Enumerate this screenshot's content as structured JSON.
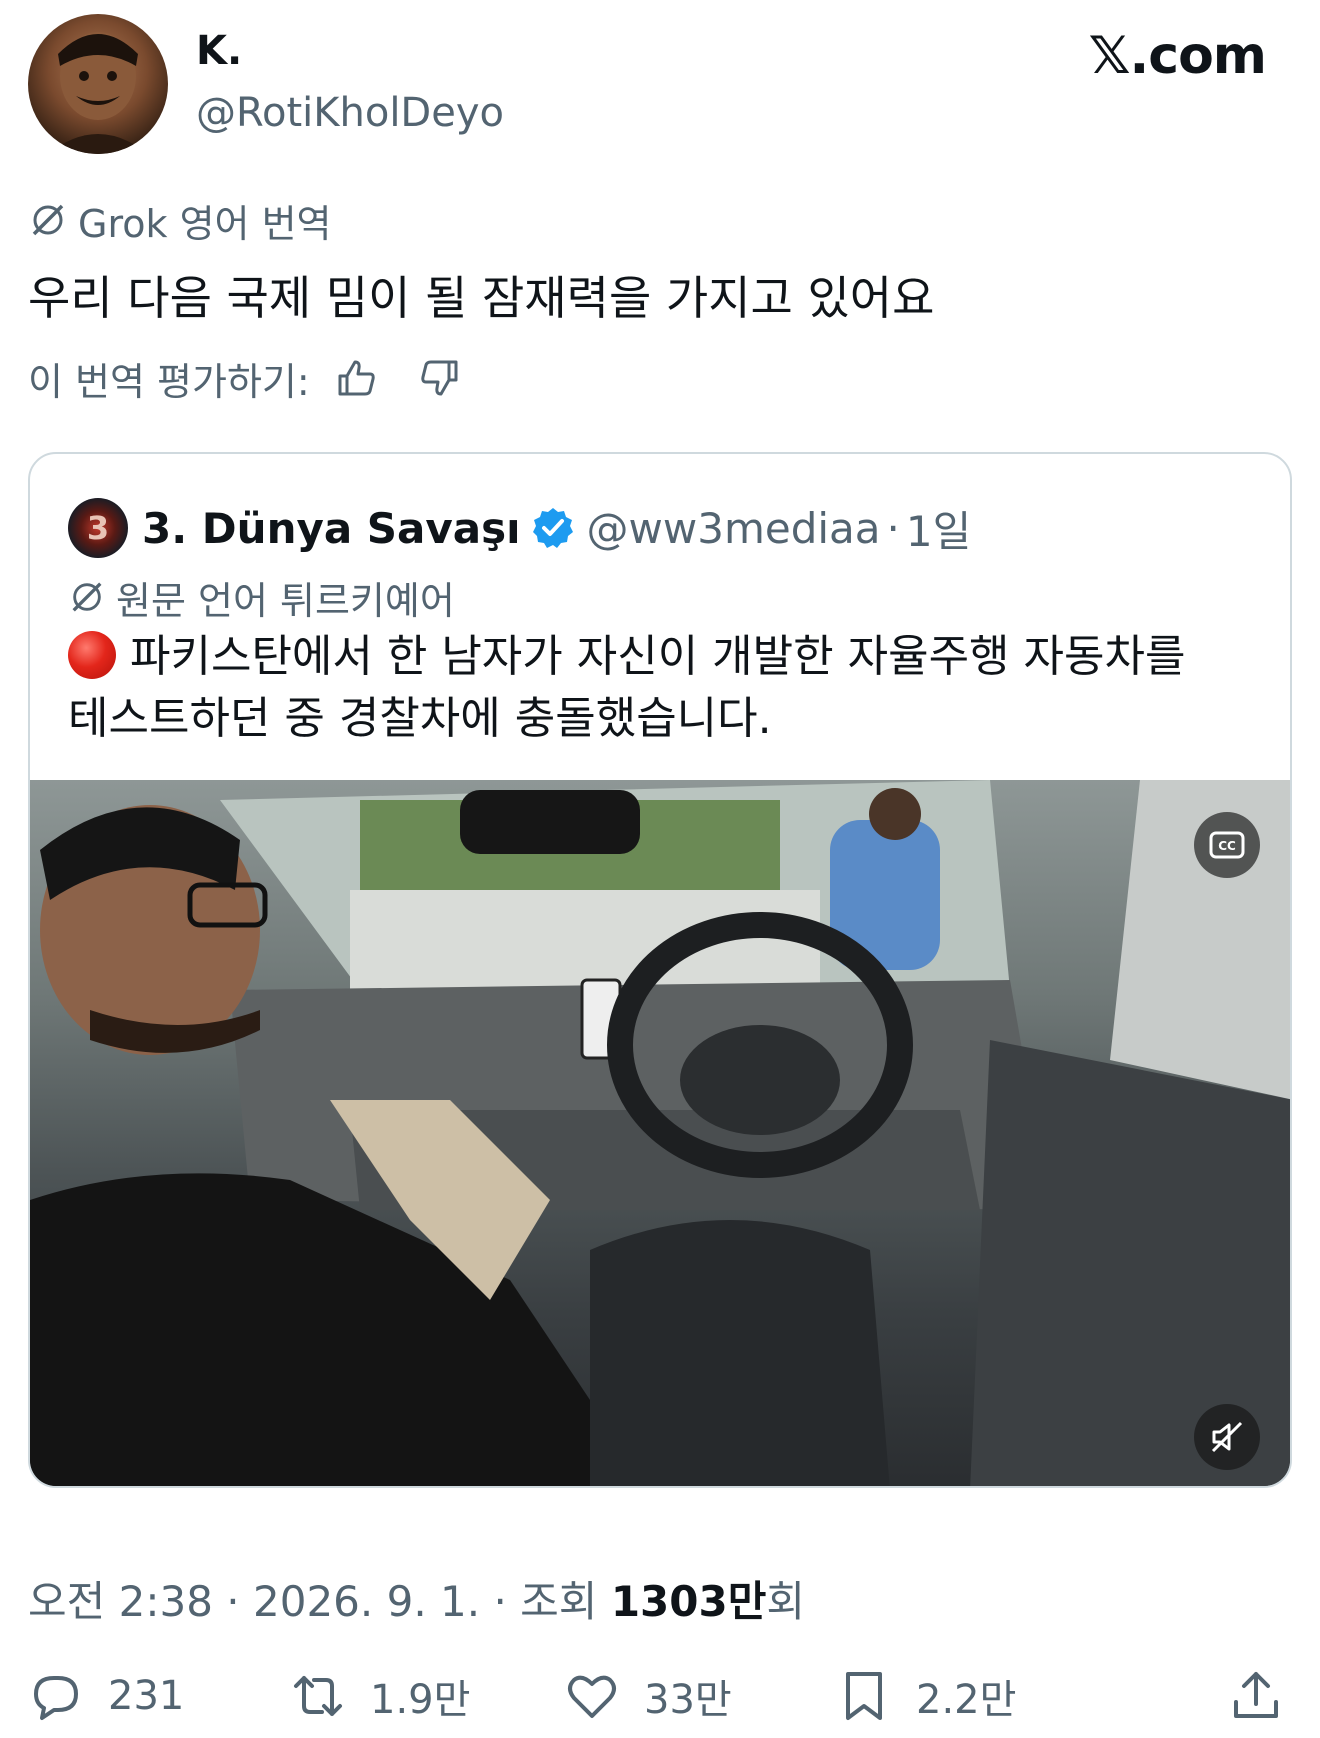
{
  "author": {
    "display_name": "K.",
    "handle": "@RotiKholDeyo",
    "avatar_icon": "avatar-image"
  },
  "brand": "𝕏.com",
  "translation": {
    "label": "Grok 영어 번역",
    "text": "우리 다음 국제 밈이 될 잠재력을 가지고 있어요",
    "rate_label": "이 번역 평가하기:"
  },
  "quote": {
    "name": "3. Dünya Savaşı",
    "avatar_label": "3",
    "handle": "@ww3mediaa",
    "separator": "·",
    "time": "1일",
    "lang_label": "원문 언어 튀르키예어",
    "text_line1": "파키스탄에서 한 남자가 자신이 개발한 자율주행 자동차를",
    "text_line2": "테스트하던 중 경찰차에 충돌했습니다."
  },
  "meta": {
    "time": "오전 2:38",
    "sep1": " · ",
    "date": "2026. 9. 1.",
    "sep2": " · ",
    "views_label": "조회 ",
    "views_count": "1303만",
    "views_suffix": "회"
  },
  "actions": {
    "replies": "231",
    "reposts": "1.9만",
    "likes": "33만",
    "bookmarks": "2.2만"
  },
  "colors": {
    "accent_blue": "#1d9bf0",
    "muted": "#536471",
    "text": "#0f1419",
    "border": "#cfd9de"
  }
}
